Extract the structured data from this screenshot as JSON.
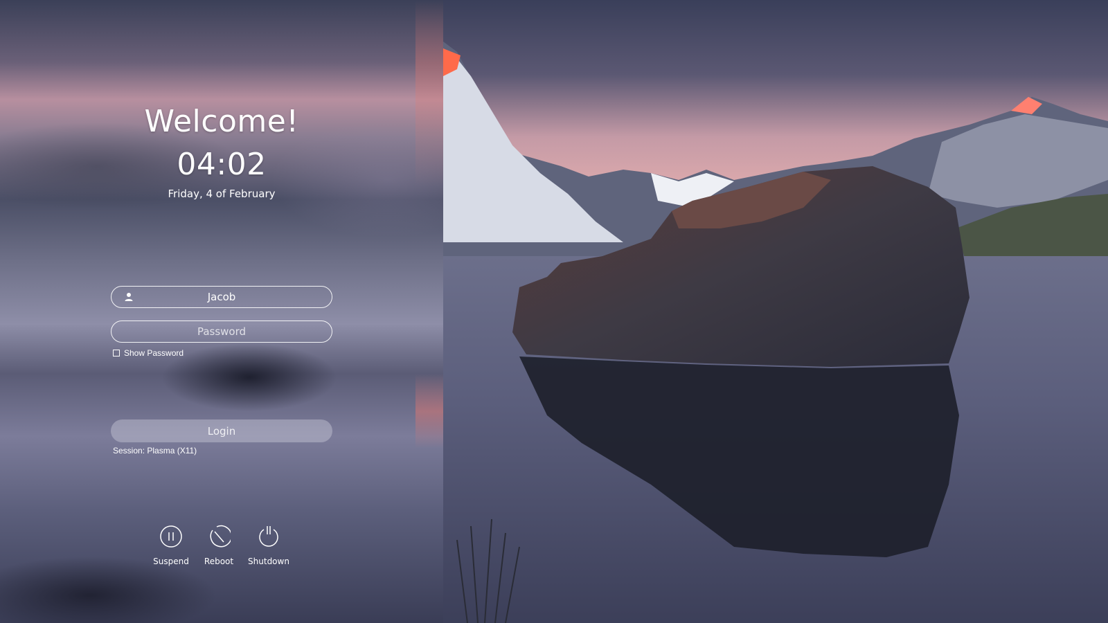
{
  "greeting": "Welcome!",
  "clock": {
    "time": "04:02",
    "date": "Friday, 4 of February"
  },
  "login_form": {
    "username": "Jacob",
    "password_placeholder": "Password",
    "show_password_label": "Show Password",
    "show_password_checked": false,
    "login_button": "Login",
    "session_label": "Session: Plasma (X11)"
  },
  "power_actions": [
    {
      "label": "Suspend",
      "icon": "pause-circle-icon"
    },
    {
      "label": "Reboot",
      "icon": "reboot-icon"
    },
    {
      "label": "Shutdown",
      "icon": "power-icon"
    }
  ],
  "colors": {
    "text": "#ffffff",
    "field_border": "#ffffff"
  }
}
